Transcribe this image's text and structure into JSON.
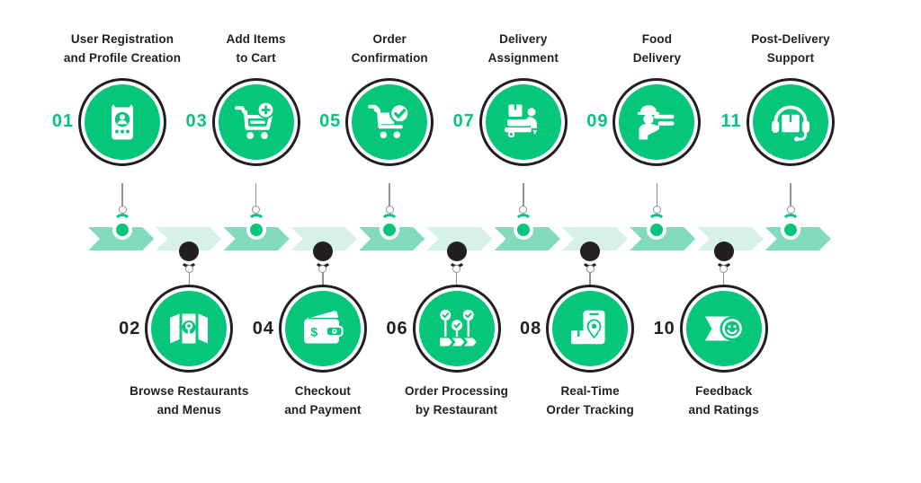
{
  "theme": {
    "primary_green": "#06C67C",
    "chevron_mid": "#82DCBC",
    "chevron_light": "#D6F2E7",
    "dark": "#231f20",
    "stem_gray": "#8d9295",
    "background": "#ffffff"
  },
  "steps": [
    {
      "number": "01",
      "label": "User Registration\nand Profile Creation",
      "icon": "mobile-profile-icon",
      "row": "top",
      "number_color": "green"
    },
    {
      "number": "02",
      "label": "Browse Restaurants\nand Menus",
      "icon": "map-location-icon",
      "row": "bottom",
      "number_color": "dark"
    },
    {
      "number": "03",
      "label": "Add Items\nto Cart",
      "icon": "cart-plus-icon",
      "row": "top",
      "number_color": "green"
    },
    {
      "number": "04",
      "label": "Checkout\nand Payment",
      "icon": "wallet-money-icon",
      "row": "bottom",
      "number_color": "dark"
    },
    {
      "number": "05",
      "label": "Order\nConfirmation",
      "icon": "cart-check-icon",
      "row": "top",
      "number_color": "green"
    },
    {
      "number": "06",
      "label": "Order Processing\nby Restaurant",
      "icon": "workflow-check-icon",
      "row": "bottom",
      "number_color": "dark"
    },
    {
      "number": "07",
      "label": "Delivery\nAssignment",
      "icon": "delivery-scooter-icon",
      "row": "top",
      "number_color": "green"
    },
    {
      "number": "08",
      "label": "Real-Time\nOrder Tracking",
      "icon": "phone-tracking-icon",
      "row": "bottom",
      "number_color": "dark"
    },
    {
      "number": "09",
      "label": "Food\nDelivery",
      "icon": "delivery-person-icon",
      "row": "top",
      "number_color": "green"
    },
    {
      "number": "10",
      "label": "Feedback\nand Ratings",
      "icon": "feedback-smile-icon",
      "row": "bottom",
      "number_color": "dark"
    },
    {
      "number": "11",
      "label": "Post-Delivery\nSupport",
      "icon": "headset-support-icon",
      "row": "top",
      "number_color": "green"
    }
  ],
  "track": {
    "segment_count": 11,
    "segments": [
      "mid",
      "light",
      "mid",
      "light",
      "mid",
      "light",
      "mid",
      "light",
      "mid",
      "light",
      "mid"
    ]
  }
}
